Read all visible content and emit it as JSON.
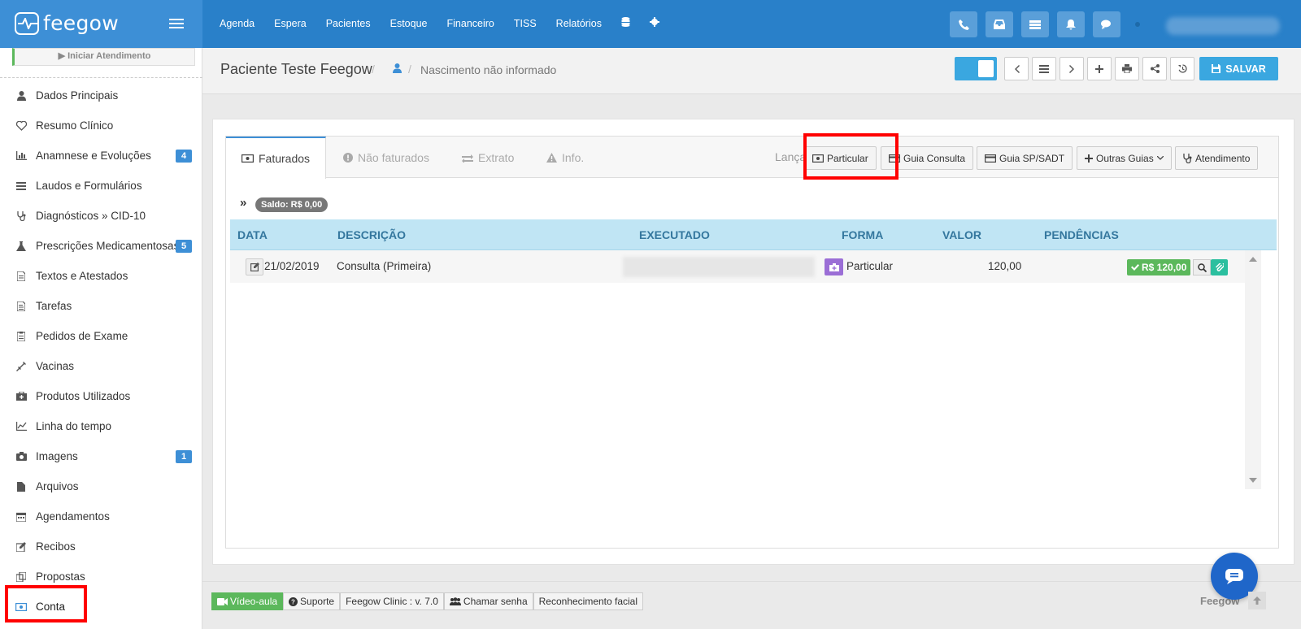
{
  "brand": {
    "logo_text": "feegow"
  },
  "nav": {
    "items": [
      "Agenda",
      "Espera",
      "Pacientes",
      "Estoque",
      "Financeiro",
      "TISS",
      "Relatórios"
    ]
  },
  "top_icons": [
    "phone-icon",
    "inbox-icon",
    "card-icon",
    "bell-icon",
    "chat-icon"
  ],
  "sidebar": {
    "iniciar_label": "Iniciar Atendimento",
    "items": [
      {
        "label": "Dados Principais",
        "icon": "user-icon"
      },
      {
        "label": "Resumo Clínico",
        "icon": "heart-icon"
      },
      {
        "label": "Anamnese e Evoluções",
        "icon": "bar-chart-icon",
        "badge": "4"
      },
      {
        "label": "Laudos e Formulários",
        "icon": "list-icon"
      },
      {
        "label": "Diagnósticos » CID-10",
        "icon": "stethoscope-icon"
      },
      {
        "label": "Prescrições Medicamentosas",
        "icon": "flask-icon",
        "badge": "5"
      },
      {
        "label": "Textos e Atestados",
        "icon": "document-icon"
      },
      {
        "label": "Tarefas",
        "icon": "task-icon"
      },
      {
        "label": "Pedidos de Exame",
        "icon": "clipboard-icon"
      },
      {
        "label": "Vacinas",
        "icon": "syringe-icon"
      },
      {
        "label": "Produtos Utilizados",
        "icon": "medkit-icon"
      },
      {
        "label": "Linha do tempo",
        "icon": "line-chart-icon"
      },
      {
        "label": "Imagens",
        "icon": "camera-icon",
        "badge": "1"
      },
      {
        "label": "Arquivos",
        "icon": "file-icon"
      },
      {
        "label": "Agendamentos",
        "icon": "calendar-icon"
      },
      {
        "label": "Recibos",
        "icon": "edit-icon"
      },
      {
        "label": "Propostas",
        "icon": "copy-icon"
      },
      {
        "label": "Conta",
        "icon": "money-icon"
      }
    ]
  },
  "header": {
    "patient_name": "Paciente Teste Feegow",
    "sep": "/",
    "birth": "Nascimento não informado",
    "save_label": "SALVAR"
  },
  "tabs": [
    {
      "label": "Faturados",
      "icon": "money-icon"
    },
    {
      "label": "Não faturados",
      "icon": "exclamation-circle-icon"
    },
    {
      "label": "Extrato",
      "icon": "exchange-icon"
    },
    {
      "label": "Info.",
      "icon": "warning-icon"
    }
  ],
  "launch": {
    "label": "Lançar",
    "particular": "Particular",
    "guia_consulta": "Guia Consulta",
    "guia_sadt": "Guia SP/SADT",
    "outras_guias": "Outras Guias",
    "atendimento": "Atendimento"
  },
  "saldo": {
    "arrow": "»",
    "label": "Saldo: R$ 0,00"
  },
  "table": {
    "columns": [
      "DATA",
      "DESCRIÇÃO",
      "EXECUTADO",
      "FORMA",
      "VALOR",
      "PENDÊNCIAS"
    ],
    "rows": [
      {
        "data": "21/02/2019",
        "descricao": "Consulta (Primeira)",
        "forma": "Particular",
        "valor": "120,00",
        "pendencia": "R$ 120,00"
      }
    ]
  },
  "footer": {
    "video": "Vídeo-aula",
    "suporte": "Suporte",
    "versao": "Feegow Clinic : v. 7.0",
    "chamar": "Chamar senha",
    "reconhecimento": "Reconhecimento facial",
    "brand": "Feegow"
  },
  "colors": {
    "topbar": "#2980c9",
    "accent": "#3aa7e0",
    "highlight": "#ff0000",
    "success": "#5cb85c"
  }
}
